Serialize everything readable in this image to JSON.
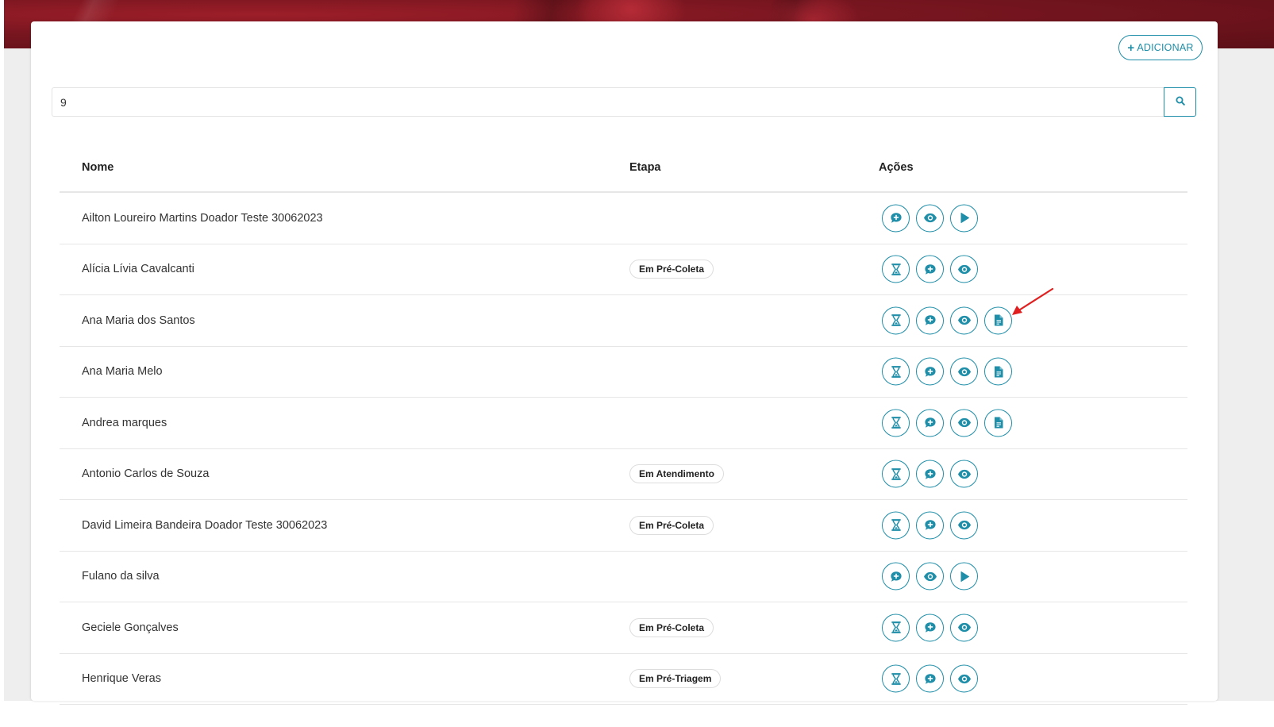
{
  "colors": {
    "accent": "#1f8ea8",
    "hero": "#7a1620",
    "annotation": "#e02020"
  },
  "toolbar": {
    "add_label": "ADICIONAR",
    "add_icon": "plus-icon"
  },
  "search": {
    "value": "9",
    "button_icon": "search-icon"
  },
  "table": {
    "headers": {
      "name": "Nome",
      "stage": "Etapa",
      "actions": "Ações"
    },
    "rows": [
      {
        "name": "Ailton Loureiro Martins Doador Teste 30062023",
        "stage": "",
        "actions": [
          "chat-plus",
          "view",
          "play"
        ]
      },
      {
        "name": "Alícia Lívia Cavalcanti",
        "stage": "Em Pré-Coleta",
        "actions": [
          "hourglass",
          "chat-plus",
          "view"
        ]
      },
      {
        "name": "Ana Maria dos Santos",
        "stage": "",
        "actions": [
          "hourglass",
          "chat-plus",
          "view",
          "document"
        ]
      },
      {
        "name": "Ana Maria Melo",
        "stage": "",
        "actions": [
          "hourglass",
          "chat-plus",
          "view",
          "document"
        ]
      },
      {
        "name": "Andrea marques",
        "stage": "",
        "actions": [
          "hourglass",
          "chat-plus",
          "view",
          "document"
        ]
      },
      {
        "name": "Antonio Carlos de Souza",
        "stage": "Em Atendimento",
        "actions": [
          "hourglass",
          "chat-plus",
          "view"
        ]
      },
      {
        "name": "David Limeira Bandeira Doador Teste 30062023",
        "stage": "Em Pré-Coleta",
        "actions": [
          "hourglass",
          "chat-plus",
          "view"
        ]
      },
      {
        "name": "Fulano da silva",
        "stage": "",
        "actions": [
          "chat-plus",
          "view",
          "play"
        ]
      },
      {
        "name": "Geciele Gonçalves",
        "stage": "Em Pré-Coleta",
        "actions": [
          "hourglass",
          "chat-plus",
          "view"
        ]
      },
      {
        "name": "Henrique Veras",
        "stage": "Em Pré-Triagem",
        "actions": [
          "hourglass",
          "chat-plus",
          "view"
        ]
      }
    ]
  }
}
